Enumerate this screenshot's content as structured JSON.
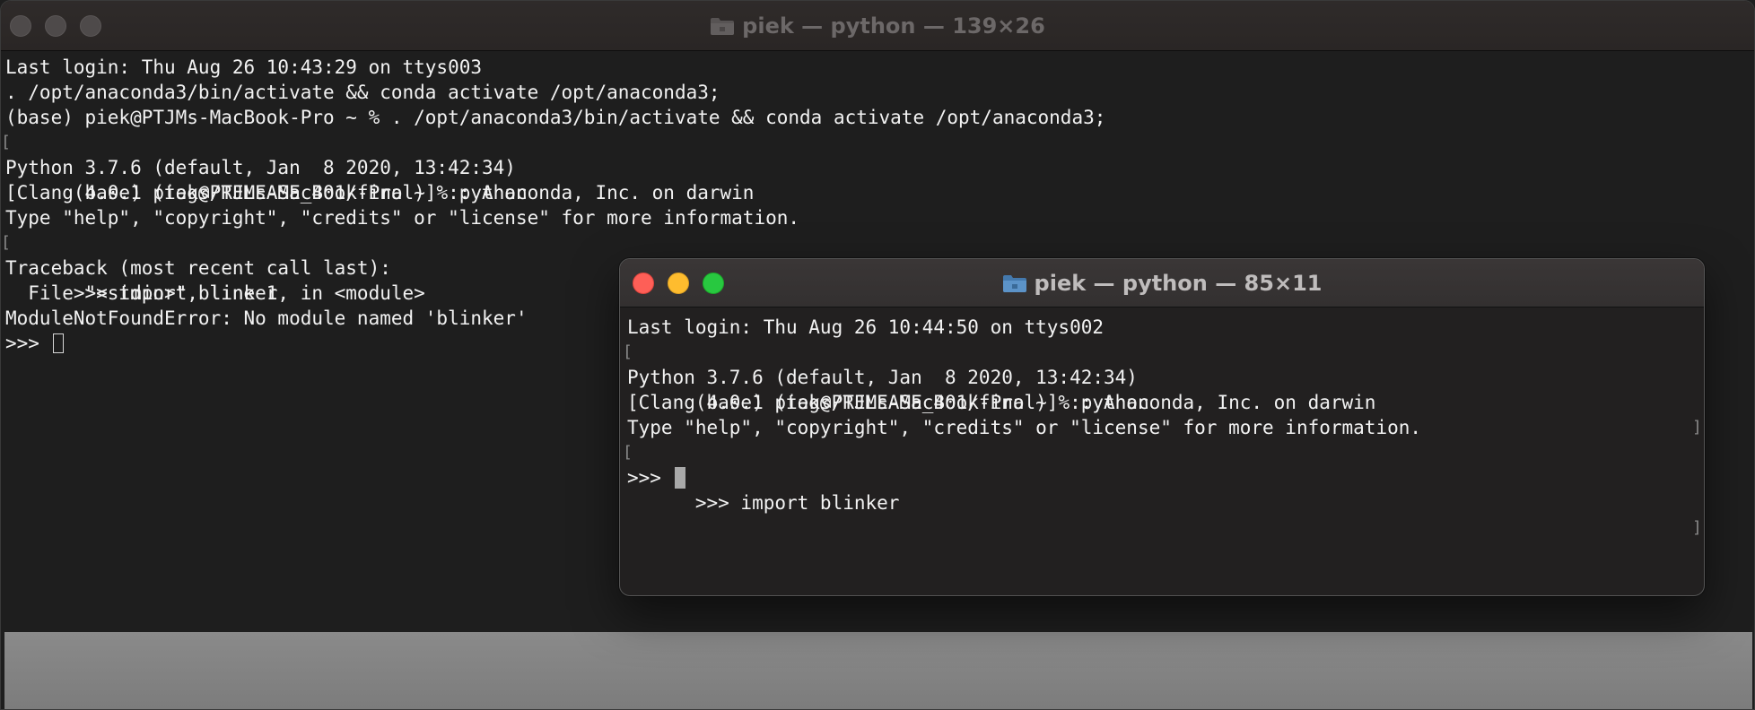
{
  "back_window": {
    "title": "piek — python — 139×26",
    "lines": [
      "Last login: Thu Aug 26 10:43:29 on ttys003",
      ". /opt/anaconda3/bin/activate && conda activate /opt/anaconda3;",
      "(base) piek@PTJMs-MacBook-Pro ~ % . /opt/anaconda3/bin/activate && conda activate /opt/anaconda3;",
      "(base) piek@PTJMs-MacBook-Pro ~ % python",
      "Python 3.7.6 (default, Jan  8 2020, 13:42:34)",
      "[Clang 4.0.1 (tags/RELEASE_401/final)] :: Anaconda, Inc. on darwin",
      "Type \"help\", \"copyright\", \"credits\" or \"license\" for more information.",
      ">>> import blinker",
      "Traceback (most recent call last):",
      "  File \"<stdin>\", line 1, in <module>",
      "ModuleNotFoundError: No module named 'blinker'",
      ">>> "
    ]
  },
  "front_window": {
    "title": "piek — python — 85×11",
    "lines": [
      "Last login: Thu Aug 26 10:44:50 on ttys002",
      "(base) piek@PTJMs-MacBook-Pro ~ % python",
      "Python 3.7.6 (default, Jan  8 2020, 13:42:34)",
      "[Clang 4.0.1 (tags/RELEASE_401/final)] :: Anaconda, Inc. on darwin",
      "Type \"help\", \"copyright\", \"credits\" or \"license\" for more information.",
      ">>> import blinker",
      ">>> "
    ]
  },
  "marks": {
    "left": "[",
    "right": "]"
  },
  "icons": {
    "folder": "folder-icon",
    "close": "close-icon",
    "minimize": "minimize-icon",
    "zoom": "zoom-icon"
  },
  "colors": {
    "terminal_bg": "#1e1e1e",
    "text": "#f2f2f2",
    "close": "#fe5f57",
    "minimize": "#febc2e",
    "zoom": "#28c840",
    "folder": "#5c93c8"
  }
}
